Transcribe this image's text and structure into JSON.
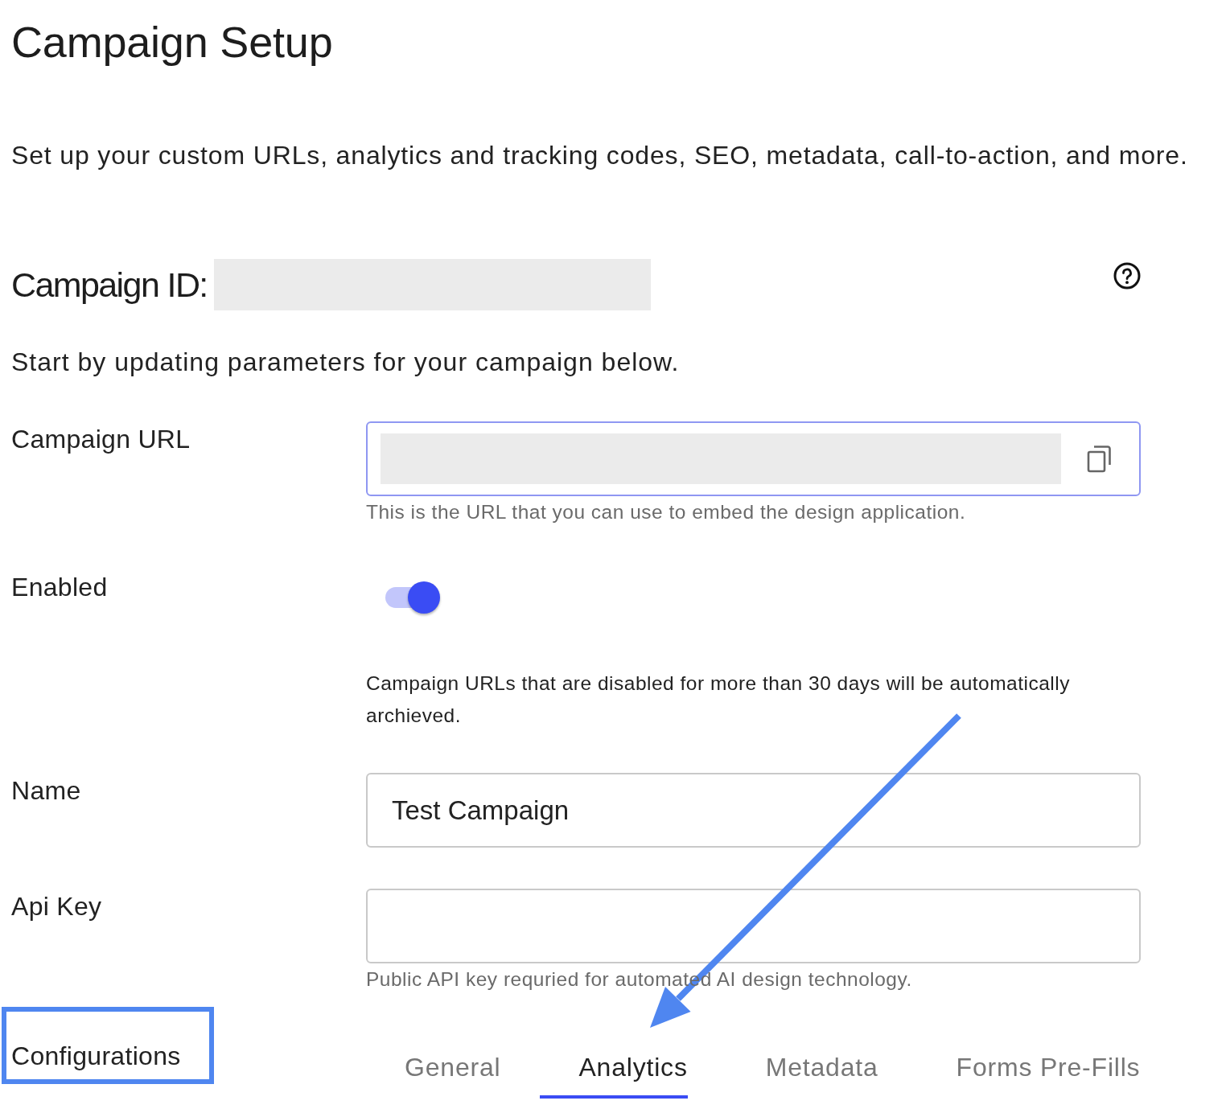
{
  "title": "Campaign Setup",
  "description": "Set up your custom URLs, analytics and tracking codes, SEO, metadata, call-to-action, and more.",
  "campaign_id": {
    "label": "Campaign ID:"
  },
  "intro": "Start by updating parameters for your campaign below.",
  "fields": [
    {
      "kind": "url",
      "label": "Campaign URL",
      "focused": true,
      "helper": "This is the URL that you can use to embed the design application."
    },
    {
      "kind": "toggle",
      "label": "Enabled",
      "on": true,
      "note": "Campaign URLs that are disabled for more than 30 days will be automatically archieved."
    },
    {
      "kind": "text",
      "label": "Name",
      "focused": false,
      "value": "Test Campaign"
    },
    {
      "kind": "text",
      "label": "Api Key",
      "focused": false,
      "helper": "Public API key requried for automated AI design technology."
    }
  ],
  "configurations": {
    "label": "Configurations",
    "tabs": [
      {
        "label": "General",
        "selected": false
      },
      {
        "label": "Analytics",
        "selected": true
      },
      {
        "label": "Metadata",
        "selected": false
      },
      {
        "label": "Forms Pre-Fills",
        "selected": false
      }
    ]
  }
}
